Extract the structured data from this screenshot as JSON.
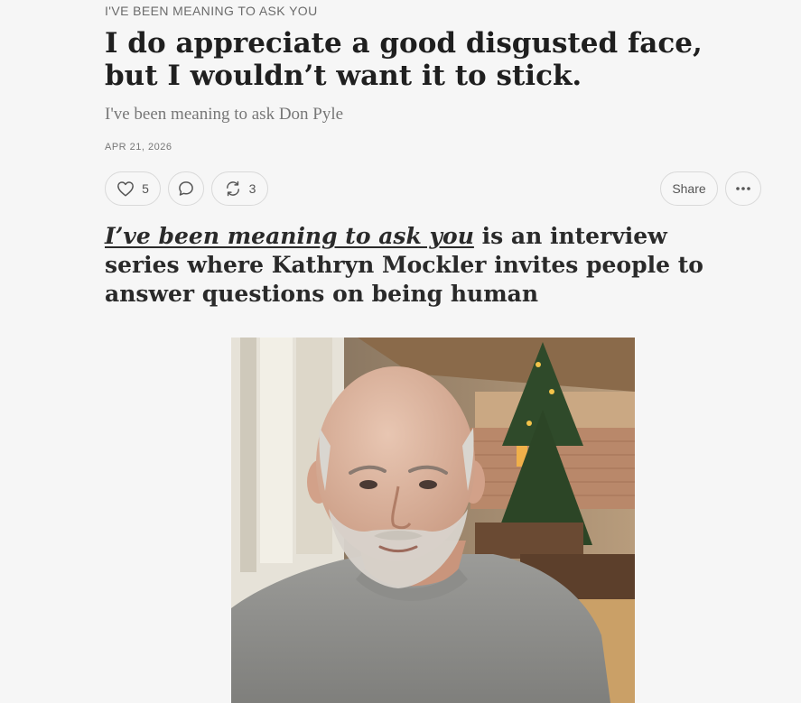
{
  "post": {
    "kicker": "I'VE BEEN MEANING TO ASK YOU",
    "title": "I do appreciate a good disgusted face, but I wouldn’t want it to stick.",
    "subtitle": "I've been meaning to ask Don Pyle",
    "date": "APR 21, 2026"
  },
  "actions": {
    "like_icon": "heart-icon",
    "like_count": "5",
    "comment_icon": "speech-bubble-icon",
    "restack_icon": "restack-icon",
    "restack_count": "3",
    "share_label": "Share",
    "more_icon": "ellipsis-icon"
  },
  "lede": {
    "link_text": "I’ve been meaning to ask you",
    "rest_text": " is an interview series where Kathryn Mockler invites people to answer questions on being human"
  },
  "photo": {
    "subject": "portrait-photo"
  },
  "colors": {
    "background": "#f6f6f6",
    "text": "#222222",
    "muted": "#777777",
    "border": "#d9d9d9"
  }
}
